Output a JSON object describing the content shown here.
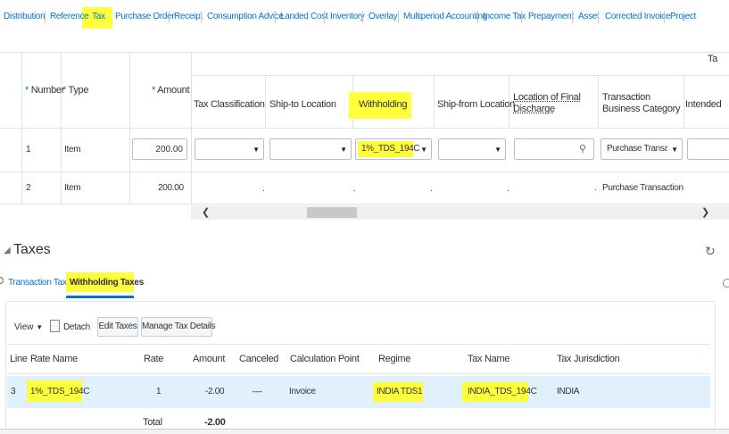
{
  "tabs": [
    {
      "label": "Distribution"
    },
    {
      "label": "Reference"
    },
    {
      "label": "Tax"
    },
    {
      "label": "Purchase Order"
    },
    {
      "label": "Receipt"
    },
    {
      "label": "Consumption Advice"
    },
    {
      "label": "Landed Cost"
    },
    {
      "label": "Inventory"
    },
    {
      "label": "Overlay"
    },
    {
      "label": "Multiperiod Accounting"
    },
    {
      "label": "Income Tax"
    },
    {
      "label": "Prepayment"
    },
    {
      "label": "Asset"
    },
    {
      "label": "Corrected Invoice"
    },
    {
      "label": "Project"
    }
  ],
  "lines_table": {
    "top_header_cut": "Ta",
    "required_marker": "*",
    "columns": {
      "number": "Number",
      "type": "Type",
      "amount": "Amount",
      "tax_classification": "Tax Classification",
      "ship_to": "Ship-to Location",
      "withholding": "Withholding",
      "ship_from": "Ship-from Location",
      "final_discharge": "Location of Final Discharge",
      "business_category": "Transaction Business Category",
      "intended": "Intended"
    },
    "rows": [
      {
        "number": "1",
        "type": "Item",
        "amount": "200.00",
        "withholding": "1%_TDS_194C",
        "business_category": "Purchase Transacti"
      },
      {
        "number": "2",
        "type": "Item",
        "amount": "200.00",
        "dots": ".",
        "business_category": "Purchase Transaction"
      }
    ]
  },
  "taxes_section": {
    "title": "Taxes",
    "subtabs": {
      "transaction": "Transaction Taxes",
      "withholding": "Withholding Taxes"
    },
    "toolbar": {
      "view": "View",
      "detach": "Detach",
      "edit_taxes": "Edit Taxes",
      "manage": "Manage Tax Details"
    },
    "columns": {
      "line": "Line",
      "rate_name": "Rate Name",
      "rate": "Rate",
      "amount": "Amount",
      "canceled": "Canceled",
      "calc_point": "Calculation Point",
      "regime": "Regime",
      "tax_name": "Tax Name",
      "jurisdiction": "Tax Jurisdiction"
    },
    "row": {
      "line": "3",
      "rate_name": "1%_TDS_194C",
      "rate": "1",
      "amount": "-2.00",
      "canceled": "__",
      "calc_point": "Invoice",
      "regime": "INDIA TDS1",
      "tax_name": "INDIA_TDS_194C",
      "jurisdiction": "INDIA"
    },
    "total_label": "Total",
    "total_value": "-2.00"
  },
  "colors": {
    "link": "#0572ce",
    "highlight": "#ffff3b",
    "selected_row": "#e0f0fc"
  }
}
